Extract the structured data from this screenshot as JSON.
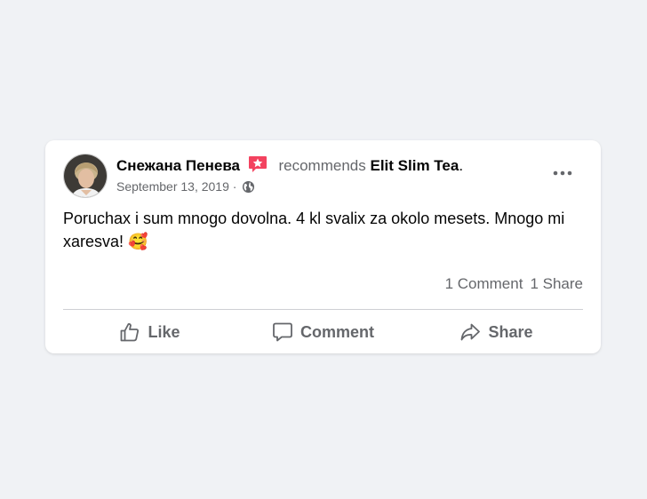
{
  "post": {
    "author": "Снежана Пенева",
    "action_word": "recommends",
    "page_name": "Elit Slim Tea",
    "punctuation": ".",
    "date": "September 13, 2019",
    "separator": "·",
    "text": "Poruchax i sum mnogo dovolna. 4 kl svalix za okolo mesets. Mnogo mi xaresva!",
    "emoji": "🥰",
    "icons": {
      "recommend_badge": "recommend-star-icon",
      "privacy": "globe-icon",
      "more": "more-dots-icon"
    }
  },
  "stats": {
    "comments": "1 Comment",
    "shares": "1 Share"
  },
  "actions": {
    "like": "Like",
    "comment": "Comment",
    "share": "Share"
  },
  "colors": {
    "page_bg": "#f0f2f5",
    "card_bg": "#ffffff",
    "muted_text": "#65676b",
    "badge": "#f3425f"
  }
}
